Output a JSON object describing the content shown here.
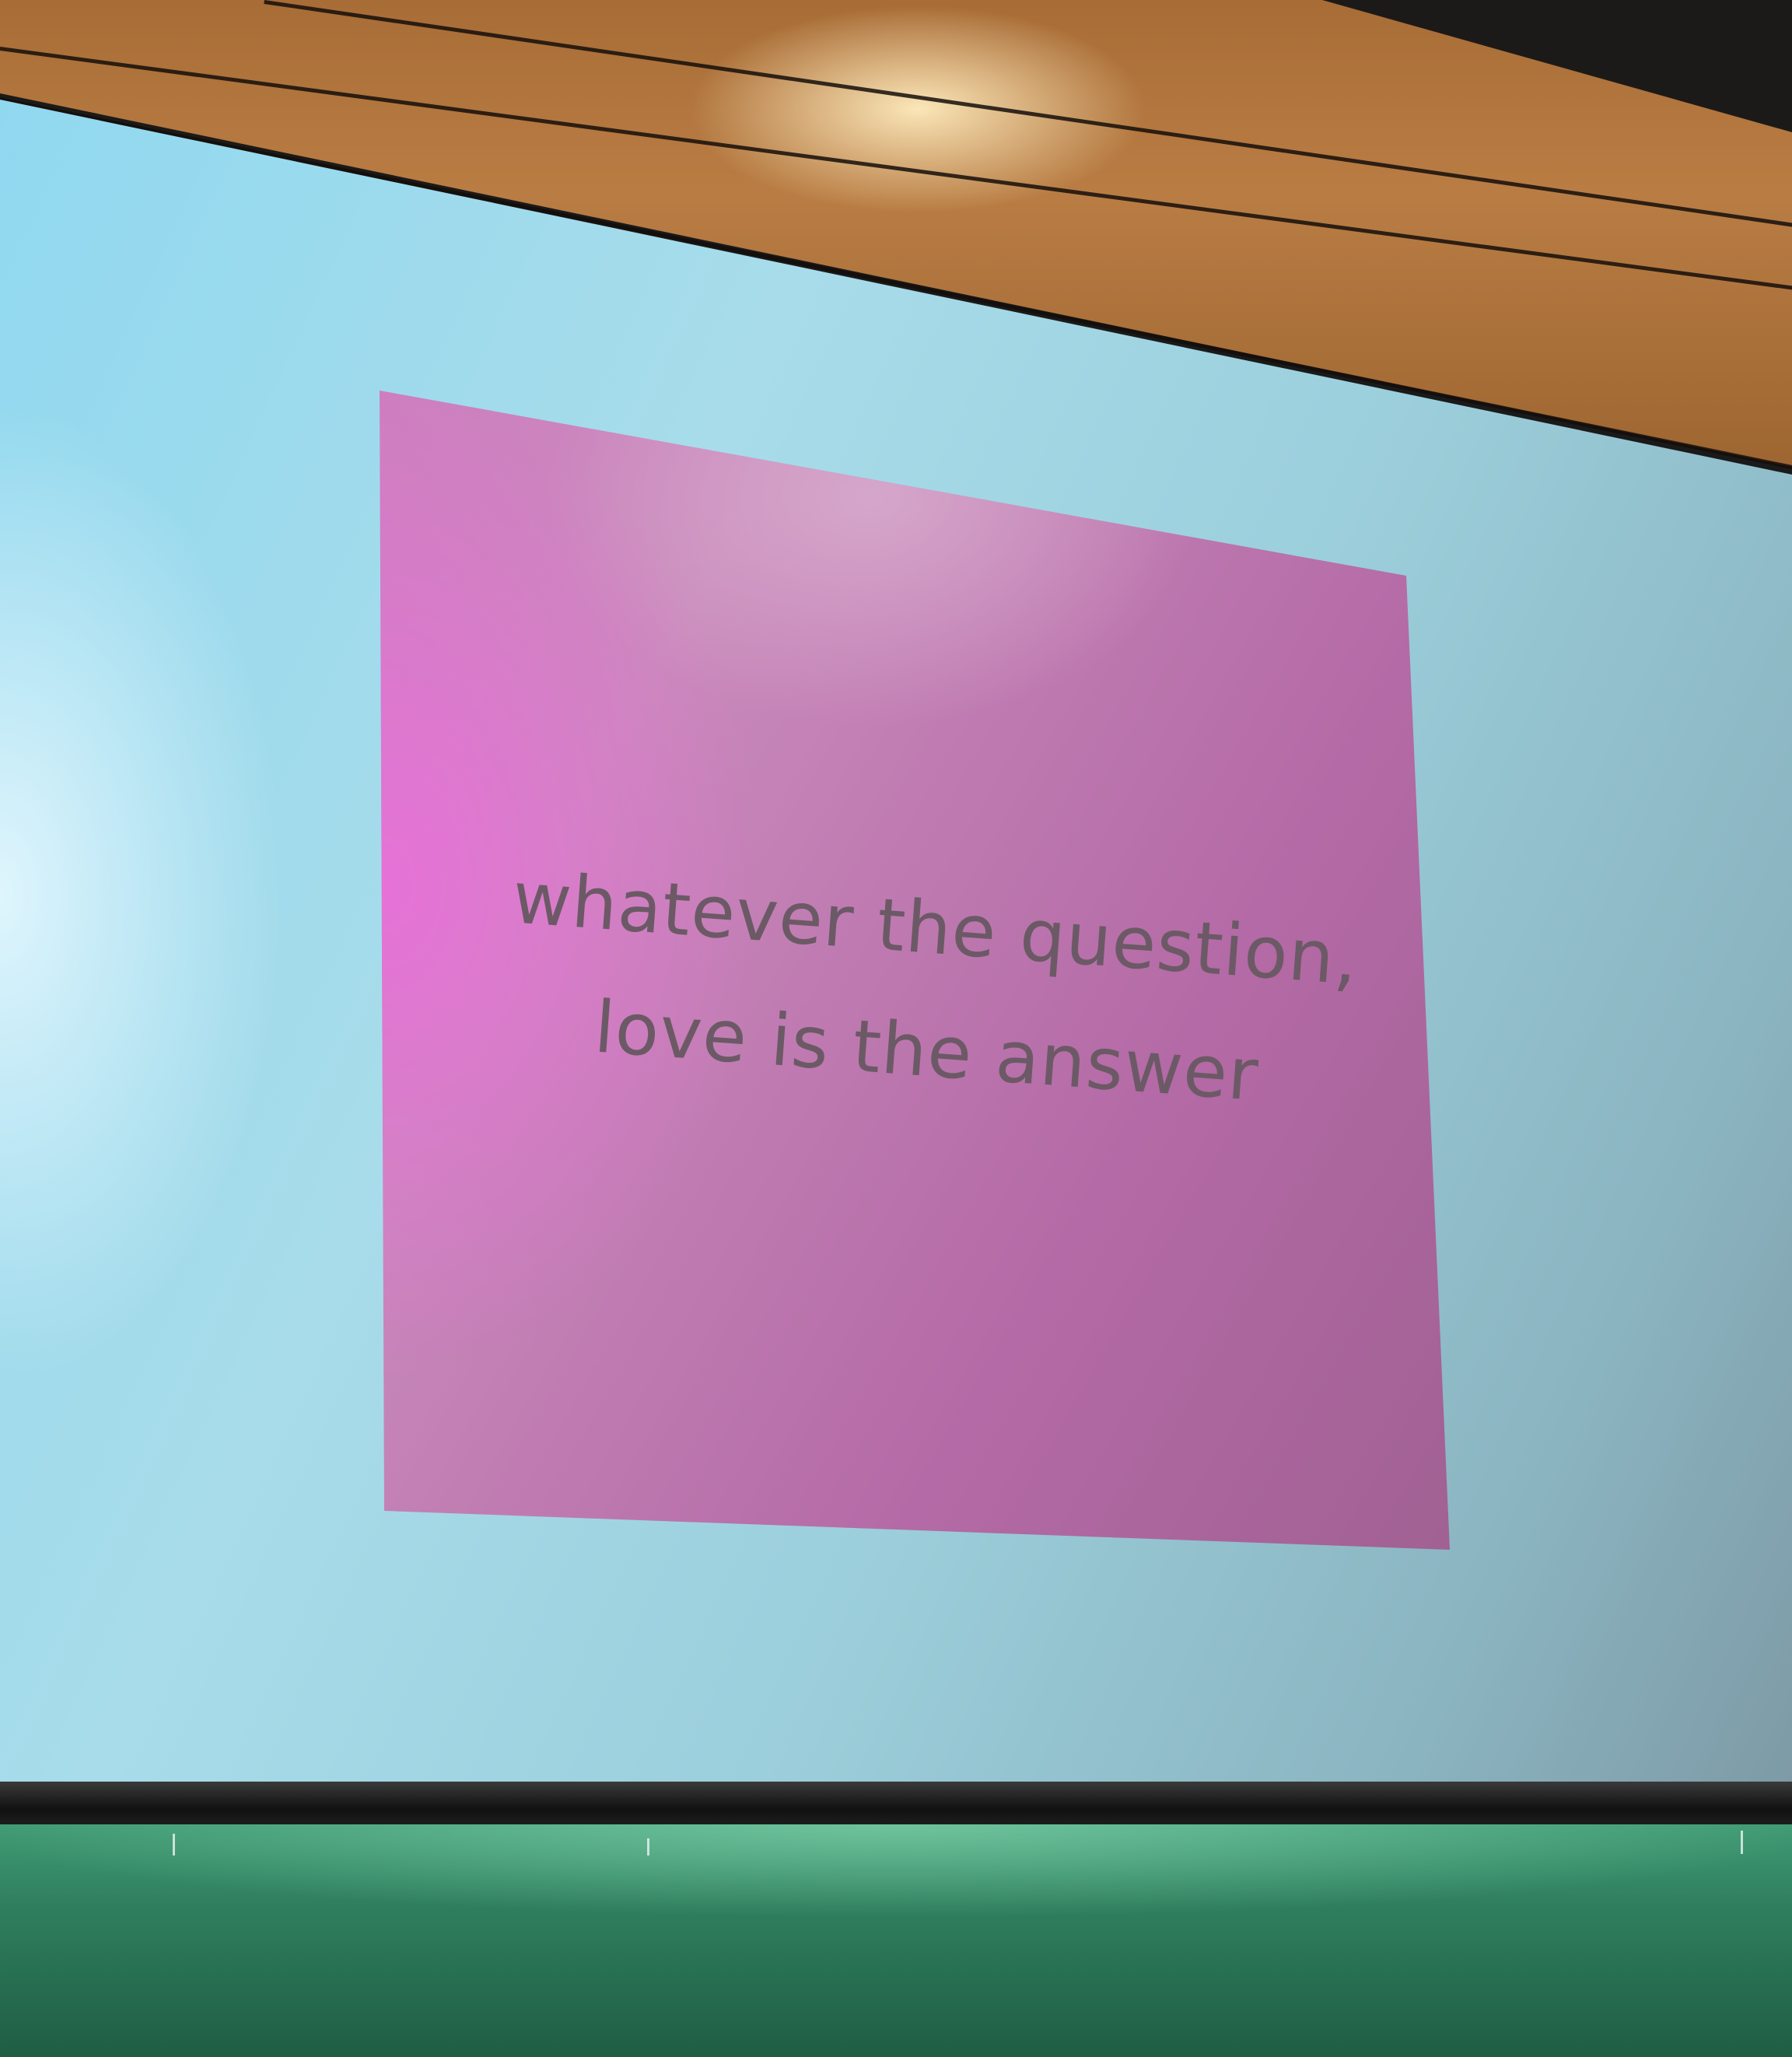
{
  "slide": {
    "line1": "whatever the question,",
    "line2": "love is the answer"
  },
  "colors": {
    "slide_pink": "#c97bbd",
    "screen_blue": "#9fd6e8",
    "wood": "#b07540",
    "board_green": "#2f7f5e",
    "text_gray": "#6c5966"
  }
}
